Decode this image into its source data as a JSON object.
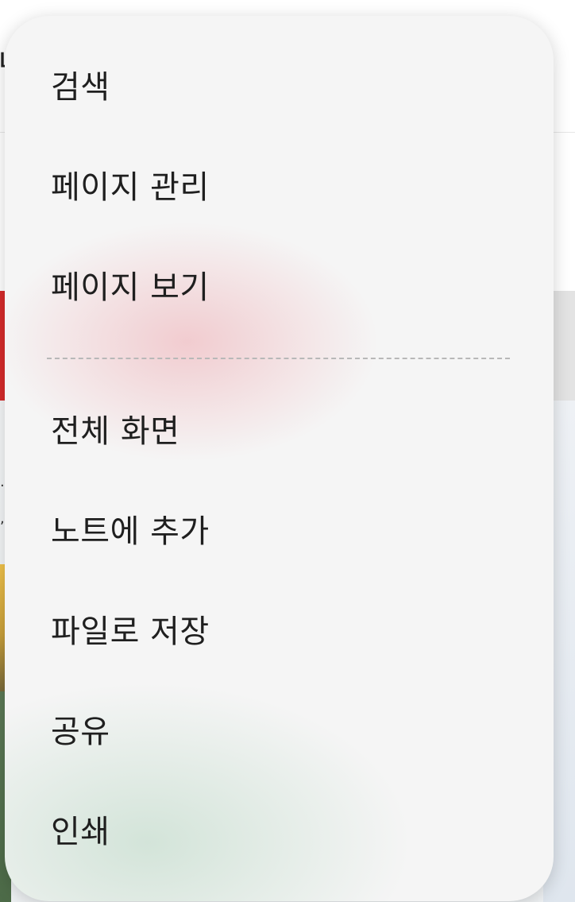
{
  "background": {
    "top_glyph": "ㄴ",
    "side_marks": ".\n,"
  },
  "menu": {
    "items": [
      {
        "label": "검색"
      },
      {
        "label": "페이지 관리"
      },
      {
        "label": "페이지 보기"
      },
      {
        "label": "전체 화면"
      },
      {
        "label": "노트에 추가"
      },
      {
        "label": "파일로 저장"
      },
      {
        "label": "공유"
      },
      {
        "label": "인쇄"
      }
    ]
  },
  "colors": {
    "menu_background": "#f5f5f5",
    "text": "#1f1f1f",
    "accent_red": "#d52b2b"
  }
}
